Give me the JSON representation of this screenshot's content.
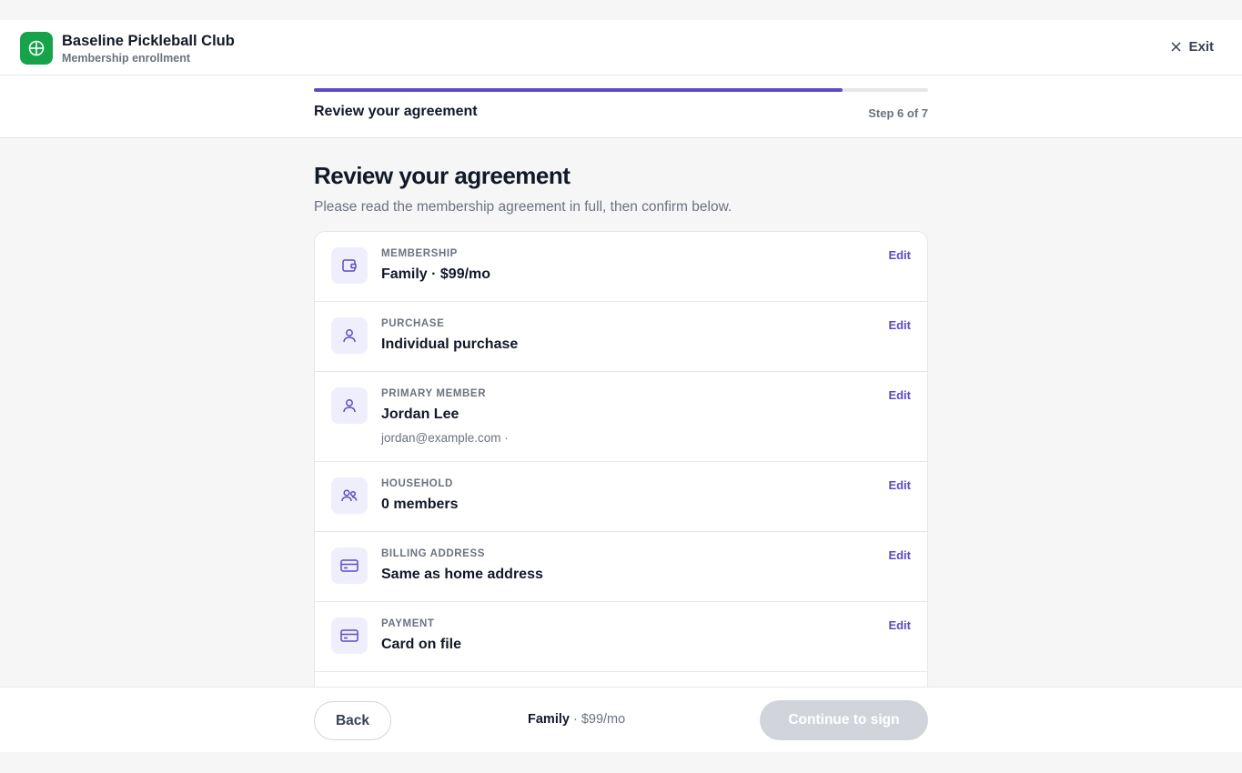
{
  "app": {
    "name": "Baseline Pickleball Club",
    "subtitle": "Membership enrollment",
    "exit_label": "Exit"
  },
  "progress": {
    "step_title": "Review your agreement",
    "step_count": "Step 6 of 7",
    "fraction": 0.86
  },
  "page": {
    "title": "Review your agreement",
    "intro": "Please read the membership agreement in full, then confirm below."
  },
  "rows": [
    {
      "label": "MEMBERSHIP",
      "value": "Family · $99/mo",
      "sub": "",
      "edit": "Edit",
      "icon": "wallet-icon"
    },
    {
      "label": "PURCHASE",
      "value": "Individual purchase",
      "sub": "",
      "edit": "Edit",
      "icon": "user-icon"
    },
    {
      "label": "PRIMARY MEMBER",
      "value": "Jordan Lee",
      "sub": "jordan@example.com ·",
      "edit": "Edit",
      "icon": "user-icon"
    },
    {
      "label": "HOUSEHOLD",
      "value": "0 members",
      "sub": "",
      "edit": "Edit",
      "icon": "users-icon"
    },
    {
      "label": "BILLING ADDRESS",
      "value": "Same as home address",
      "sub": "",
      "edit": "Edit",
      "icon": "credit-card-icon"
    },
    {
      "label": "PAYMENT",
      "value": "Card on file",
      "sub": "",
      "edit": "Edit",
      "icon": "credit-card-icon"
    }
  ],
  "footer": {
    "back_label": "Back",
    "plan": "Family",
    "price": " · $99/mo",
    "continue_label": "Continue to sign"
  },
  "colors": {
    "accent": "#5b4cc4",
    "brand": "#16a34a",
    "disabled": "#d1d5db"
  }
}
